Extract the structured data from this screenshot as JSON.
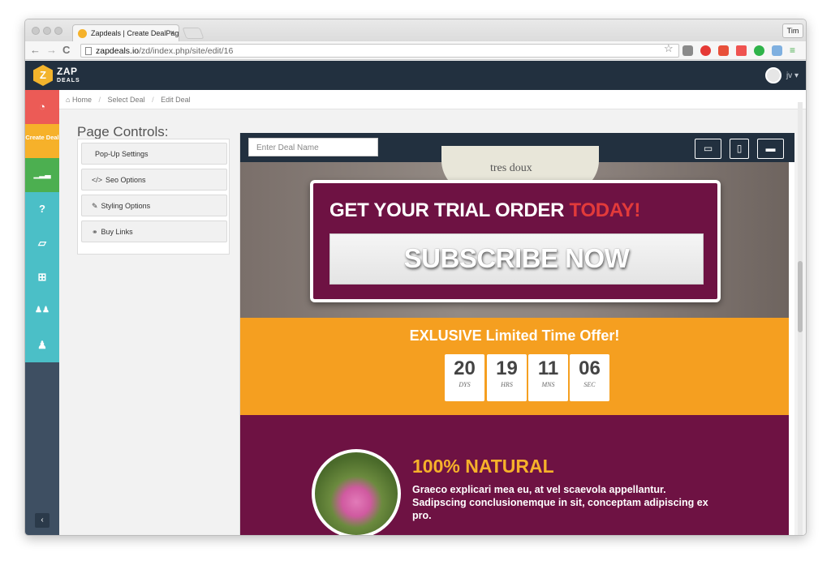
{
  "browser": {
    "tab_title": "Zapdeals | Create DealPag",
    "tab_close": "×",
    "user_button": "Tim",
    "url_host": "zapdeals.io",
    "url_path": "/zd/index.php/site/edit/16",
    "back": "←",
    "forward": "→",
    "reload": "C"
  },
  "app": {
    "brand_top": "ZAP",
    "brand_bottom": "DEALS",
    "user_initials": "jv",
    "user_caret": "▾"
  },
  "sidebar": {
    "create_label": "Create Deal",
    "collapse": "‹",
    "items": [
      {
        "icon": "dashboard-icon",
        "glyph": "◔",
        "color": "#ec5b56"
      },
      {
        "icon": "create-deal",
        "glyph": "",
        "color": "#f6b12a"
      },
      {
        "icon": "stats-icon",
        "glyph": "▁▂▃",
        "color": "#4caf50"
      },
      {
        "icon": "help-icon",
        "glyph": "?",
        "color": "#4bbfc7"
      },
      {
        "icon": "book-icon",
        "glyph": "▱",
        "color": "#4bbfc7"
      },
      {
        "icon": "gift-icon",
        "glyph": "⊞",
        "color": "#4bbfc7"
      },
      {
        "icon": "users-icon",
        "glyph": "♟♟",
        "color": "#4bbfc7"
      },
      {
        "icon": "user-icon",
        "glyph": "♟",
        "color": "#4bbfc7"
      }
    ]
  },
  "breadcrumb": {
    "home": "Home",
    "select": "Select Deal",
    "edit": "Edit Deal",
    "sep": "/"
  },
  "controls": {
    "title": "Page Controls:",
    "items": [
      {
        "label": "Pop-Up Settings",
        "icon": ""
      },
      {
        "label": "Seo Options",
        "icon": "</>"
      },
      {
        "label": "Styling Options",
        "icon": "✎"
      },
      {
        "label": "Buy Links",
        "icon": "⚭"
      }
    ]
  },
  "editor": {
    "deal_name_placeholder": "Enter Deal Name",
    "device_laptop": "▭",
    "device_mobile": "▯",
    "device_desktop": "▬"
  },
  "hero": {
    "bottle_text": "tres doux",
    "headline_main": "GET YOUR TRIAL ORDER ",
    "headline_accent": "TODAY!",
    "subscribe_button": "SUBSCRIBE NOW"
  },
  "offer": {
    "title": "EXLUSIVE Limited Time Offer!",
    "countdown": [
      {
        "value": "20",
        "unit": "DYS"
      },
      {
        "value": "19",
        "unit": "HRS"
      },
      {
        "value": "11",
        "unit": "MNS"
      },
      {
        "value": "06",
        "unit": "SEC"
      }
    ]
  },
  "feature": {
    "title": "100% NATURAL",
    "text": "Graeco explicari mea eu, at vel scaevola appellantur. Sadipscing conclusionemque in sit, conceptam adipiscing ex pro."
  },
  "colors": {
    "accent_purple": "#6e1243",
    "accent_orange": "#f59f20",
    "accent_yellow": "#f6b12a",
    "navbar": "#22303f"
  }
}
